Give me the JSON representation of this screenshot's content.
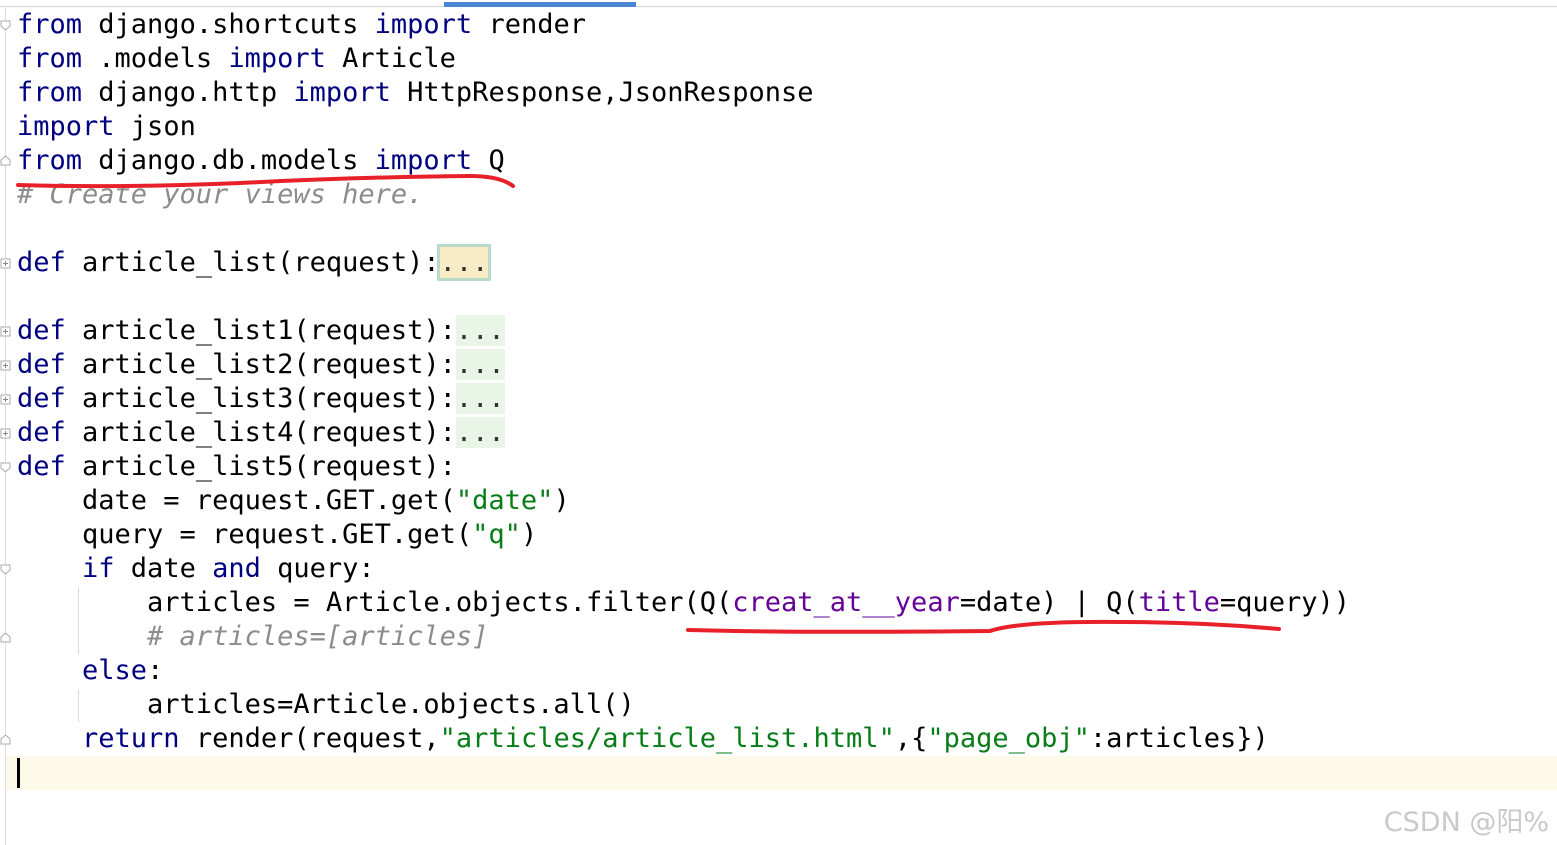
{
  "editor": {
    "lines": [
      {
        "t1": "from",
        "t2": " django.shortcuts ",
        "t3": "import",
        "t4": " render"
      },
      {
        "t1": "from",
        "t2": " .models ",
        "t3": "import",
        "t4": " Article"
      },
      {
        "t1": "from",
        "t2": " django.http ",
        "t3": "import",
        "t4": " HttpResponse,JsonResponse"
      },
      {
        "t1": "import",
        "t2": " json"
      },
      {
        "t1": "from",
        "t2": " django.db.models ",
        "t3": "import",
        "t4": " Q"
      },
      {
        "comment": "# Create your views here."
      },
      {
        "kw": "def",
        "name": " article_list(request):",
        "fold": "..."
      },
      {
        "kw": "def",
        "name": " article_list1(request):",
        "fold": "..."
      },
      {
        "kw": "def",
        "name": " article_list2(request):",
        "fold": "..."
      },
      {
        "kw": "def",
        "name": " article_list3(request):",
        "fold": "..."
      },
      {
        "kw": "def",
        "name": " article_list4(request):",
        "fold": "..."
      },
      {
        "kw": "def",
        "name": " article_list5(request):"
      },
      {
        "a": "    date = request.GET.get(",
        "s": "\"date\"",
        "b": ")"
      },
      {
        "a": "    query = request.GET.get(",
        "s": "\"q\"",
        "b": ")"
      },
      {
        "k1": "if",
        "m1": " date ",
        "k2": "and",
        "m2": " query:"
      },
      {
        "a": "        articles = Article.objects.filter(Q(",
        "kw1": "creat_at__year",
        "b": "=date) | Q(",
        "kw2": "title",
        "c": "=query))"
      },
      {
        "comment": "        # articles=[articles]"
      },
      {
        "k1": "else",
        "m1": ":"
      },
      {
        "a": "        articles=Article.objects.all()"
      },
      {
        "k1": "return",
        "a": " render(request,",
        "s1": "\"articles/article_list.html\"",
        "b": ",{",
        "s2": "\"page_obj\"",
        "c": ":articles})"
      }
    ]
  },
  "watermark": "CSDN @阳%"
}
